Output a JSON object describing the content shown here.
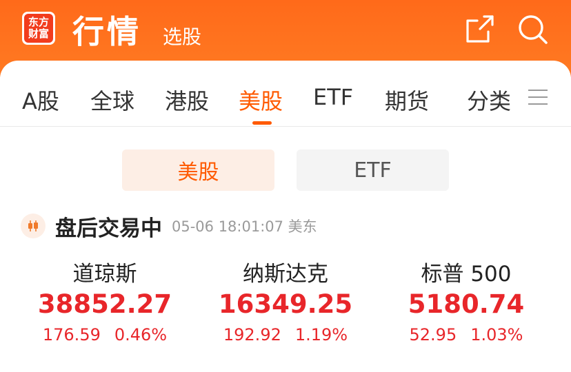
{
  "header": {
    "logo_line1": "东方",
    "logo_line2": "财富",
    "title": "行情",
    "subtitle": "选股",
    "icons": [
      "share-icon",
      "search-icon"
    ]
  },
  "tabs": [
    {
      "label": "A股"
    },
    {
      "label": "全球"
    },
    {
      "label": "港股"
    },
    {
      "label": "美股",
      "active": true
    },
    {
      "label": "ETF"
    },
    {
      "label": "期货"
    },
    {
      "label": "分类"
    }
  ],
  "segments": {
    "us_label": "美股",
    "etf_label": "ETF"
  },
  "status": {
    "label": "盘后交易中",
    "time": "05-06 18:01:07 美东"
  },
  "indices": [
    {
      "name": "道琼斯",
      "value": "38852.27",
      "change": "176.59",
      "pct": "0.46%"
    },
    {
      "name": "纳斯达克",
      "value": "16349.25",
      "change": "192.92",
      "pct": "1.19%"
    },
    {
      "name": "标普 500",
      "value": "5180.74",
      "change": "52.95",
      "pct": "1.03%"
    }
  ],
  "colors": {
    "brand": "#ff6a1a",
    "accent": "#ff5a00",
    "up": "#e8262a"
  }
}
